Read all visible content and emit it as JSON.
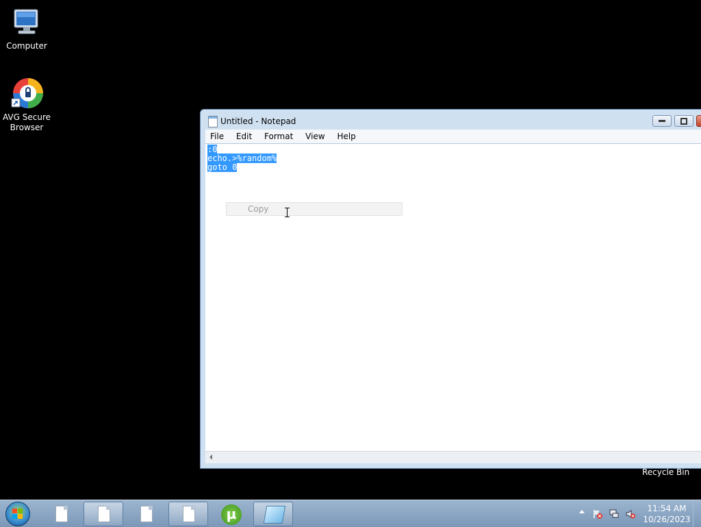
{
  "desktop": {
    "icons": [
      {
        "label": "Computer"
      },
      {
        "label": "AVG Secure Browser"
      },
      {
        "label": "Recycle Bin"
      }
    ]
  },
  "notepad": {
    "title": "Untitled - Notepad",
    "menu": [
      "File",
      "Edit",
      "Format",
      "View",
      "Help"
    ],
    "lines": [
      ":0",
      "echo.>%random%",
      "goto 0"
    ],
    "context_menu": {
      "item": "Copy"
    },
    "selection_color": "#3399ff"
  },
  "taskbar": {
    "clock_time": "11:54 AM",
    "clock_date": "10/26/2023",
    "buttons": [
      "document",
      "document",
      "document",
      "document",
      "utorrent",
      "notepad"
    ]
  },
  "colors": {
    "desktop_bg": "#000000",
    "taskbar": "#8aa7c6"
  }
}
